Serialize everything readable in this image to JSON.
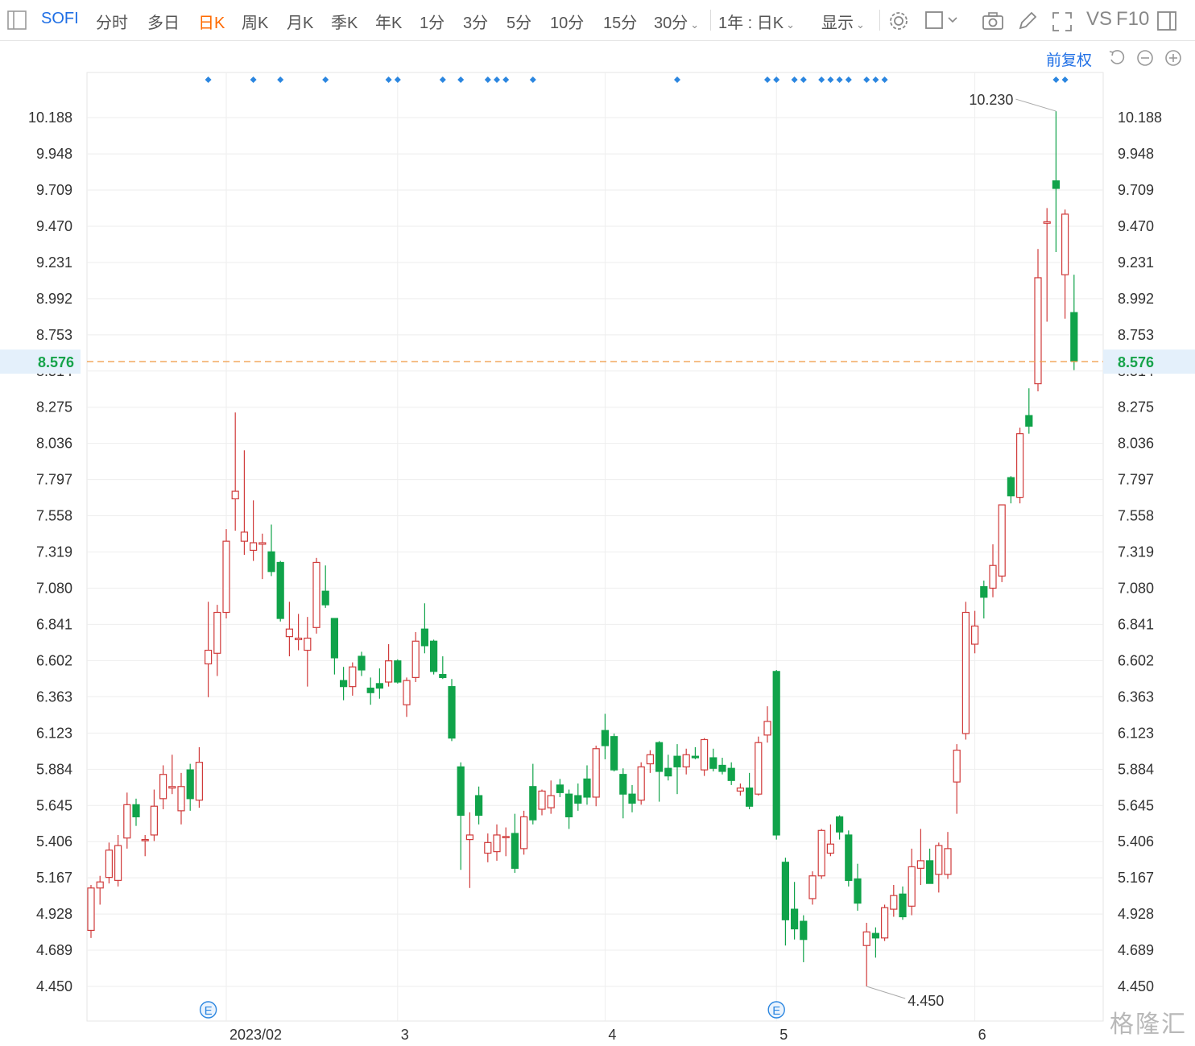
{
  "toolbar": {
    "symbol": "SOFI",
    "tabs": [
      "分时",
      "多日",
      "日K",
      "周K",
      "月K",
      "季K",
      "年K",
      "1分",
      "3分",
      "5分",
      "10分",
      "15分",
      "30分"
    ],
    "active_tab": "日K",
    "period_select": "1年 : 日K",
    "display_label": "显示",
    "vs_label": "VS",
    "f10_label": "F10"
  },
  "subbar": {
    "fuquan_label": "前复权"
  },
  "watermark": "格隆汇",
  "colors": {
    "up": "#d03b3b",
    "down": "#10a34a",
    "current_line": "#f0a050",
    "marker": "#2b86e0",
    "accent": "#ff6a00",
    "link": "#1f6fe5"
  },
  "chart_data": {
    "type": "candlestick",
    "ylim": [
      4.45,
      10.29
    ],
    "y_ticks": [
      10.188,
      9.948,
      9.709,
      9.47,
      9.231,
      8.992,
      8.753,
      8.514,
      8.275,
      8.036,
      7.797,
      7.558,
      7.319,
      7.08,
      6.841,
      6.602,
      6.363,
      6.123,
      5.884,
      5.645,
      5.406,
      5.167,
      4.928,
      4.689,
      4.45
    ],
    "y_tick_labels": [
      "10.188",
      "9.948",
      "9.709",
      "9.470",
      "9.231",
      "8.992",
      "8.753",
      "8.514",
      "8.275",
      "8.036",
      "7.797",
      "7.558",
      "7.319",
      "7.080",
      "6.841",
      "6.602",
      "6.363",
      "6.123",
      "5.884",
      "5.645",
      "5.406",
      "5.167",
      "4.928",
      "4.689",
      "4.450"
    ],
    "x_labels": [
      {
        "label": "2023/02",
        "index": 15
      },
      {
        "label": "3",
        "index": 34
      },
      {
        "label": "4",
        "index": 57
      },
      {
        "label": "5",
        "index": 76
      },
      {
        "label": "6",
        "index": 98
      }
    ],
    "current_price": 8.576,
    "current_price_label": "8.576",
    "max_annotation": {
      "label": "10.230",
      "index": 107,
      "value": 10.23
    },
    "min_annotation": {
      "label": "4.450",
      "index": 86,
      "value": 4.45
    },
    "event_markers": [
      {
        "label": "E",
        "index": 13
      },
      {
        "label": "E",
        "index": 76
      }
    ],
    "dividend_markers": [
      13,
      18,
      21,
      26,
      33,
      34,
      39,
      41,
      44,
      45,
      46,
      49,
      65,
      75,
      76,
      78,
      79,
      81,
      82,
      83,
      84,
      86,
      87,
      88,
      107,
      108
    ],
    "candles": [
      {
        "o": 4.82,
        "h": 5.12,
        "l": 4.77,
        "c": 5.1
      },
      {
        "o": 5.1,
        "h": 5.18,
        "l": 4.99,
        "c": 5.14
      },
      {
        "o": 5.17,
        "h": 5.4,
        "l": 5.13,
        "c": 5.35
      },
      {
        "o": 5.15,
        "h": 5.45,
        "l": 5.11,
        "c": 5.38
      },
      {
        "o": 5.43,
        "h": 5.73,
        "l": 5.36,
        "c": 5.65
      },
      {
        "o": 5.65,
        "h": 5.69,
        "l": 5.51,
        "c": 5.57
      },
      {
        "o": 5.42,
        "h": 5.45,
        "l": 5.31,
        "c": 5.42
      },
      {
        "o": 5.45,
        "h": 5.75,
        "l": 5.41,
        "c": 5.64
      },
      {
        "o": 5.69,
        "h": 5.91,
        "l": 5.62,
        "c": 5.85
      },
      {
        "o": 5.76,
        "h": 5.98,
        "l": 5.72,
        "c": 5.77
      },
      {
        "o": 5.61,
        "h": 5.86,
        "l": 5.52,
        "c": 5.77
      },
      {
        "o": 5.88,
        "h": 5.92,
        "l": 5.61,
        "c": 5.69
      },
      {
        "o": 5.68,
        "h": 6.03,
        "l": 5.63,
        "c": 5.93
      },
      {
        "o": 6.58,
        "h": 6.99,
        "l": 6.36,
        "c": 6.67
      },
      {
        "o": 6.65,
        "h": 6.97,
        "l": 6.5,
        "c": 6.92
      },
      {
        "o": 6.92,
        "h": 7.47,
        "l": 6.88,
        "c": 7.39
      },
      {
        "o": 7.67,
        "h": 8.24,
        "l": 7.46,
        "c": 7.72
      },
      {
        "o": 7.39,
        "h": 7.99,
        "l": 7.3,
        "c": 7.45
      },
      {
        "o": 7.33,
        "h": 7.66,
        "l": 7.26,
        "c": 7.38
      },
      {
        "o": 7.37,
        "h": 7.44,
        "l": 7.14,
        "c": 7.38
      },
      {
        "o": 7.32,
        "h": 7.5,
        "l": 7.16,
        "c": 7.19
      },
      {
        "o": 7.25,
        "h": 7.26,
        "l": 6.86,
        "c": 6.88
      },
      {
        "o": 6.76,
        "h": 6.99,
        "l": 6.63,
        "c": 6.81
      },
      {
        "o": 6.74,
        "h": 6.91,
        "l": 6.67,
        "c": 6.75
      },
      {
        "o": 6.67,
        "h": 6.89,
        "l": 6.43,
        "c": 6.75
      },
      {
        "o": 6.82,
        "h": 7.28,
        "l": 6.78,
        "c": 7.25
      },
      {
        "o": 7.06,
        "h": 7.23,
        "l": 6.95,
        "c": 6.97
      },
      {
        "o": 6.88,
        "h": 6.88,
        "l": 6.51,
        "c": 6.62
      },
      {
        "o": 6.47,
        "h": 6.56,
        "l": 6.34,
        "c": 6.43
      },
      {
        "o": 6.43,
        "h": 6.59,
        "l": 6.37,
        "c": 6.56
      },
      {
        "o": 6.63,
        "h": 6.66,
        "l": 6.5,
        "c": 6.54
      },
      {
        "o": 6.42,
        "h": 6.49,
        "l": 6.31,
        "c": 6.39
      },
      {
        "o": 6.45,
        "h": 6.55,
        "l": 6.35,
        "c": 6.42
      },
      {
        "o": 6.46,
        "h": 6.71,
        "l": 6.43,
        "c": 6.6
      },
      {
        "o": 6.6,
        "h": 6.61,
        "l": 6.45,
        "c": 6.46
      },
      {
        "o": 6.31,
        "h": 6.49,
        "l": 6.23,
        "c": 6.47
      },
      {
        "o": 6.49,
        "h": 6.79,
        "l": 6.46,
        "c": 6.73
      },
      {
        "o": 6.81,
        "h": 6.98,
        "l": 6.65,
        "c": 6.7
      },
      {
        "o": 6.73,
        "h": 6.74,
        "l": 6.51,
        "c": 6.53
      },
      {
        "o": 6.51,
        "h": 6.63,
        "l": 6.48,
        "c": 6.49
      },
      {
        "o": 6.43,
        "h": 6.48,
        "l": 6.07,
        "c": 6.09
      },
      {
        "o": 5.9,
        "h": 5.93,
        "l": 5.22,
        "c": 5.58
      },
      {
        "o": 5.42,
        "h": 5.6,
        "l": 5.1,
        "c": 5.45
      },
      {
        "o": 5.71,
        "h": 5.77,
        "l": 5.52,
        "c": 5.58
      },
      {
        "o": 5.33,
        "h": 5.46,
        "l": 5.27,
        "c": 5.4
      },
      {
        "o": 5.34,
        "h": 5.52,
        "l": 5.28,
        "c": 5.45
      },
      {
        "o": 5.44,
        "h": 5.5,
        "l": 5.31,
        "c": 5.44
      },
      {
        "o": 5.46,
        "h": 5.59,
        "l": 5.2,
        "c": 5.23
      },
      {
        "o": 5.36,
        "h": 5.61,
        "l": 5.32,
        "c": 5.57
      },
      {
        "o": 5.77,
        "h": 5.92,
        "l": 5.52,
        "c": 5.55
      },
      {
        "o": 5.62,
        "h": 5.75,
        "l": 5.58,
        "c": 5.74
      },
      {
        "o": 5.63,
        "h": 5.81,
        "l": 5.59,
        "c": 5.71
      },
      {
        "o": 5.78,
        "h": 5.82,
        "l": 5.7,
        "c": 5.73
      },
      {
        "o": 5.72,
        "h": 5.75,
        "l": 5.49,
        "c": 5.57
      },
      {
        "o": 5.71,
        "h": 5.79,
        "l": 5.61,
        "c": 5.66
      },
      {
        "o": 5.82,
        "h": 5.91,
        "l": 5.65,
        "c": 5.7
      },
      {
        "o": 5.7,
        "h": 6.04,
        "l": 5.64,
        "c": 6.02
      },
      {
        "o": 6.14,
        "h": 6.25,
        "l": 5.95,
        "c": 6.04
      },
      {
        "o": 6.1,
        "h": 6.12,
        "l": 5.87,
        "c": 5.88
      },
      {
        "o": 5.85,
        "h": 5.89,
        "l": 5.56,
        "c": 5.72
      },
      {
        "o": 5.72,
        "h": 5.78,
        "l": 5.6,
        "c": 5.66
      },
      {
        "o": 5.68,
        "h": 5.93,
        "l": 5.65,
        "c": 5.9
      },
      {
        "o": 5.92,
        "h": 6.01,
        "l": 5.86,
        "c": 5.98
      },
      {
        "o": 6.06,
        "h": 6.07,
        "l": 5.67,
        "c": 5.87
      },
      {
        "o": 5.89,
        "h": 5.98,
        "l": 5.81,
        "c": 5.84
      },
      {
        "o": 5.97,
        "h": 6.05,
        "l": 5.72,
        "c": 5.9
      },
      {
        "o": 5.9,
        "h": 6.02,
        "l": 5.85,
        "c": 5.98
      },
      {
        "o": 5.97,
        "h": 6.03,
        "l": 5.95,
        "c": 5.96
      },
      {
        "o": 5.88,
        "h": 6.09,
        "l": 5.84,
        "c": 6.08
      },
      {
        "o": 5.96,
        "h": 6.02,
        "l": 5.87,
        "c": 5.89
      },
      {
        "o": 5.91,
        "h": 5.96,
        "l": 5.85,
        "c": 5.87
      },
      {
        "o": 5.89,
        "h": 5.93,
        "l": 5.78,
        "c": 5.81
      },
      {
        "o": 5.74,
        "h": 5.79,
        "l": 5.71,
        "c": 5.76
      },
      {
        "o": 5.76,
        "h": 5.86,
        "l": 5.62,
        "c": 5.64
      },
      {
        "o": 5.72,
        "h": 6.1,
        "l": 5.71,
        "c": 6.06
      },
      {
        "o": 6.11,
        "h": 6.3,
        "l": 6.06,
        "c": 6.2
      },
      {
        "o": 6.53,
        "h": 6.54,
        "l": 5.42,
        "c": 5.45
      },
      {
        "o": 5.27,
        "h": 5.3,
        "l": 4.72,
        "c": 4.89
      },
      {
        "o": 4.96,
        "h": 5.14,
        "l": 4.76,
        "c": 4.83
      },
      {
        "o": 4.88,
        "h": 4.92,
        "l": 4.61,
        "c": 4.76
      },
      {
        "o": 5.03,
        "h": 5.21,
        "l": 4.99,
        "c": 5.18
      },
      {
        "o": 5.18,
        "h": 5.49,
        "l": 5.16,
        "c": 5.48
      },
      {
        "o": 5.33,
        "h": 5.52,
        "l": 5.31,
        "c": 5.39
      },
      {
        "o": 5.57,
        "h": 5.58,
        "l": 5.42,
        "c": 5.47
      },
      {
        "o": 5.45,
        "h": 5.48,
        "l": 5.11,
        "c": 5.15
      },
      {
        "o": 5.16,
        "h": 5.26,
        "l": 4.95,
        "c": 5.0
      },
      {
        "o": 4.72,
        "h": 4.87,
        "l": 4.45,
        "c": 4.81
      },
      {
        "o": 4.8,
        "h": 4.84,
        "l": 4.64,
        "c": 4.77
      },
      {
        "o": 4.77,
        "h": 4.99,
        "l": 4.75,
        "c": 4.97
      },
      {
        "o": 4.96,
        "h": 5.12,
        "l": 4.91,
        "c": 5.05
      },
      {
        "o": 5.06,
        "h": 5.11,
        "l": 4.89,
        "c": 4.91
      },
      {
        "o": 4.98,
        "h": 5.36,
        "l": 4.92,
        "c": 5.24
      },
      {
        "o": 5.23,
        "h": 5.49,
        "l": 5.12,
        "c": 5.28
      },
      {
        "o": 5.28,
        "h": 5.36,
        "l": 5.14,
        "c": 5.13
      },
      {
        "o": 5.19,
        "h": 5.4,
        "l": 5.07,
        "c": 5.38
      },
      {
        "o": 5.19,
        "h": 5.47,
        "l": 5.16,
        "c": 5.36
      },
      {
        "o": 5.8,
        "h": 6.05,
        "l": 5.59,
        "c": 6.01
      },
      {
        "o": 6.12,
        "h": 6.99,
        "l": 6.08,
        "c": 6.92
      },
      {
        "o": 6.71,
        "h": 6.93,
        "l": 6.65,
        "c": 6.83
      },
      {
        "o": 7.09,
        "h": 7.13,
        "l": 6.88,
        "c": 7.02
      },
      {
        "o": 7.08,
        "h": 7.37,
        "l": 7.02,
        "c": 7.23
      },
      {
        "o": 7.16,
        "h": 7.63,
        "l": 7.12,
        "c": 7.63
      },
      {
        "o": 7.81,
        "h": 7.82,
        "l": 7.64,
        "c": 7.69
      },
      {
        "o": 7.68,
        "h": 8.14,
        "l": 7.64,
        "c": 8.1
      },
      {
        "o": 8.22,
        "h": 8.4,
        "l": 8.1,
        "c": 8.15
      },
      {
        "o": 8.43,
        "h": 9.32,
        "l": 8.38,
        "c": 9.13
      },
      {
        "o": 9.49,
        "h": 9.59,
        "l": 8.84,
        "c": 9.5
      },
      {
        "o": 9.77,
        "h": 10.23,
        "l": 9.3,
        "c": 9.72
      },
      {
        "o": 9.15,
        "h": 9.58,
        "l": 8.86,
        "c": 9.55
      },
      {
        "o": 8.9,
        "h": 9.15,
        "l": 8.52,
        "c": 8.58
      }
    ]
  }
}
